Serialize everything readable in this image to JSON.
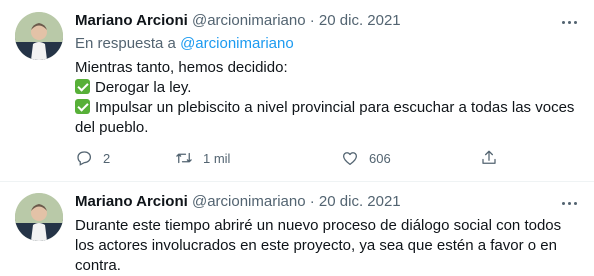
{
  "tweets": [
    {
      "name": "Mariano Arcioni",
      "handle": "@arcionimariano",
      "separator": "·",
      "date": "20 dic. 2021",
      "reply_prefix": "En respuesta a",
      "reply_handle": "@arcionimariano",
      "lines": [
        "Mientras tanto, hemos decidido:",
        "Derogar la ley.",
        "Impulsar un plebiscito a nivel provincial para escuchar a todas las voces del pueblo."
      ],
      "replies": "2",
      "retweets": "1 mil",
      "likes": "606"
    },
    {
      "name": "Mariano Arcioni",
      "handle": "@arcionimariano",
      "separator": "·",
      "date": "20 dic. 2021",
      "text": "Durante este tiempo abriré un nuevo proceso de diálogo social con todos los actores involucrados en este proyecto, ya sea que estén a favor o en contra."
    }
  ],
  "icons": {
    "more": "more-horizontal-icon",
    "reply": "reply-icon",
    "retweet": "retweet-icon",
    "like": "heart-icon",
    "share": "share-icon",
    "check": "check-mark-button-emoji"
  },
  "colors": {
    "link": "#1d9bf0",
    "secondary": "#536471",
    "primary": "#0f1419",
    "check": "#57b038"
  }
}
